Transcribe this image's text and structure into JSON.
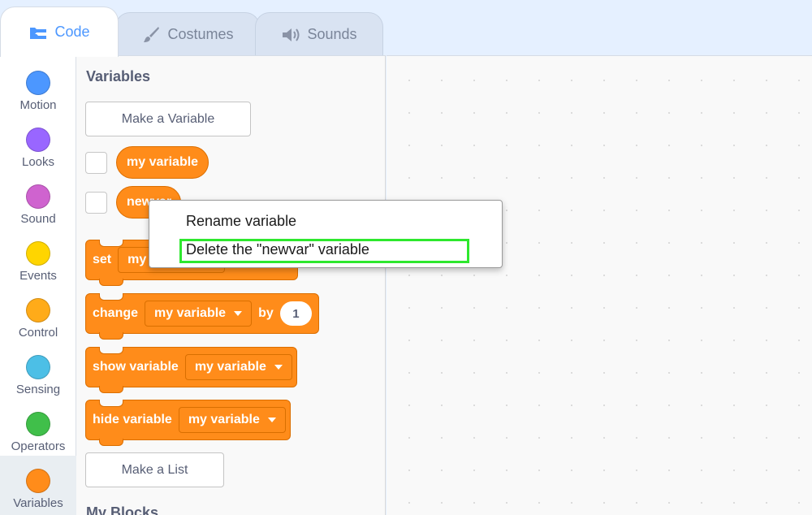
{
  "tabs": [
    {
      "label": "Code",
      "icon": "code-blocks-icon",
      "active": true
    },
    {
      "label": "Costumes",
      "icon": "paintbrush-icon",
      "active": false
    },
    {
      "label": "Sounds",
      "icon": "speaker-icon",
      "active": false
    }
  ],
  "categories": [
    {
      "label": "Motion",
      "color": "#4c97ff"
    },
    {
      "label": "Looks",
      "color": "#9966ff"
    },
    {
      "label": "Sound",
      "color": "#cf63cf"
    },
    {
      "label": "Events",
      "color": "#ffd500"
    },
    {
      "label": "Control",
      "color": "#ffab19"
    },
    {
      "label": "Sensing",
      "color": "#4cbfe6"
    },
    {
      "label": "Operators",
      "color": "#40bf4a"
    },
    {
      "label": "Variables",
      "color": "#ff8c1a",
      "selected": true
    }
  ],
  "palette": {
    "variables_title": "Variables",
    "make_variable": "Make a Variable",
    "variables": [
      "my variable",
      "newvar"
    ],
    "set_block": {
      "label": "set",
      "variable": "my variable"
    },
    "change_block": {
      "label": "change",
      "variable": "my variable",
      "by_label": "by",
      "value": "1"
    },
    "show_block": {
      "label": "show variable",
      "variable": "my variable"
    },
    "hide_block": {
      "label": "hide variable",
      "variable": "my variable"
    },
    "make_list": "Make a List",
    "my_blocks_title": "My Blocks"
  },
  "context_menu": {
    "items": [
      "Rename variable",
      "Delete the \"newvar\" variable"
    ],
    "highlight_color": "#2ee82e"
  }
}
